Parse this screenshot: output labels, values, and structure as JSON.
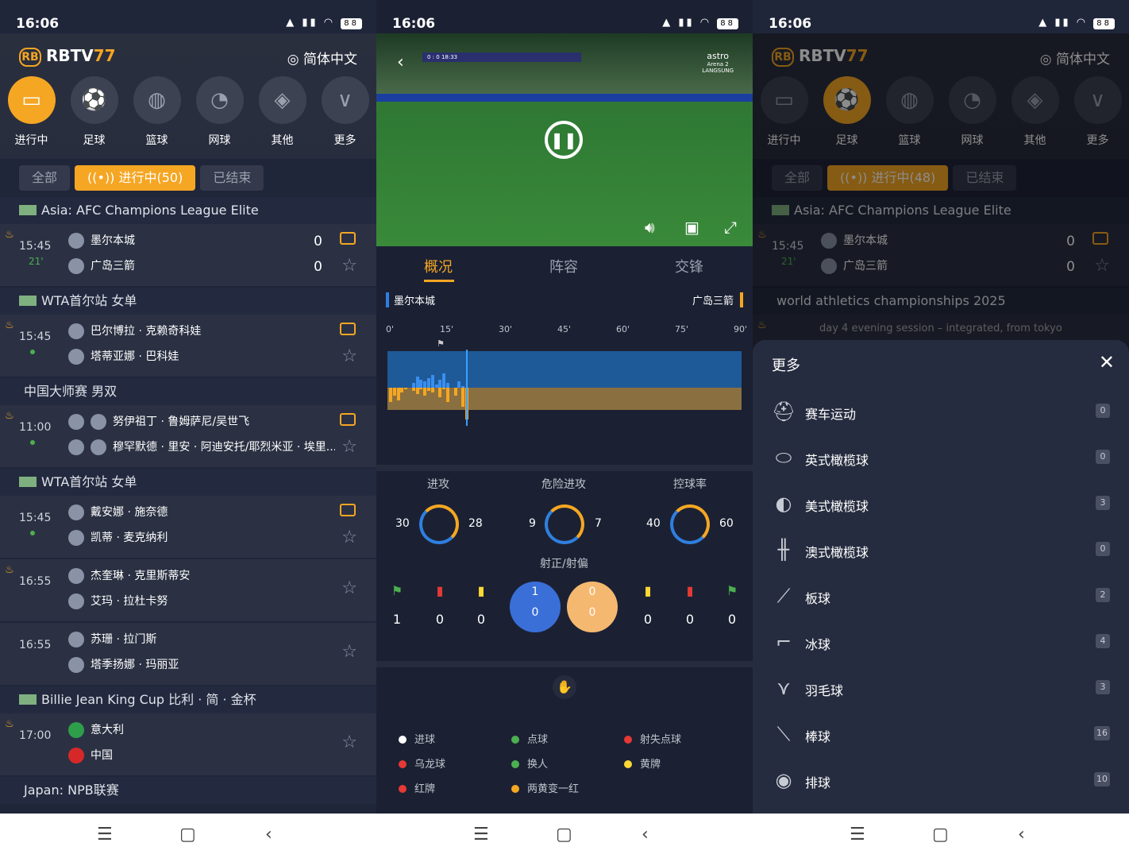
{
  "status": {
    "time": "16:06",
    "battery": "88"
  },
  "p1": {
    "logo_b": "RBTV",
    "logo_n": "77",
    "logo_rb": "RB",
    "lang": "简体中文",
    "cats": [
      "进行中",
      "足球",
      "篮球",
      "网球",
      "其他",
      "更多"
    ],
    "tabs": [
      "全部",
      "((•)) 进行中(50)",
      "已结束"
    ],
    "l1": "Asia: AFC Champions League Elite",
    "m1": {
      "time": "15:45",
      "min": "21'",
      "t1": "墨尔本城",
      "t2": "广岛三箭",
      "s1": "0",
      "s2": "0"
    },
    "l2": "WTA首尔站 女单",
    "m2": {
      "time": "15:45",
      "t1": "巴尔博拉 · 克赖奇科娃",
      "t2": "塔蒂亚娜 · 巴科娃"
    },
    "l3": "中国大师赛 男双",
    "m3": {
      "time": "11:00",
      "t1": "努伊祖丁 · 鲁姆萨尼/吴世飞",
      "t2": "穆罕默德 · 里安 · 阿迪安托/耶烈米亚 · 埃里..."
    },
    "l4": "WTA首尔站 女单",
    "m4": {
      "time": "15:45",
      "t1": "戴安娜 · 施奈德",
      "t2": "凯蒂 · 麦克纳利"
    },
    "m5": {
      "time": "16:55",
      "t1": "杰奎琳 · 克里斯蒂安",
      "t2": "艾玛 · 拉杜卡努"
    },
    "m6": {
      "time": "16:55",
      "t1": "苏珊 · 拉门斯",
      "t2": "塔季扬娜 · 玛丽亚"
    },
    "l5": "Billie Jean King Cup 比利 · 简 · 金杯",
    "m7": {
      "time": "17:00",
      "t1": "意大利",
      "t2": "中国"
    },
    "l6": "Japan: NPB联赛"
  },
  "p2": {
    "tabs": [
      "概况",
      "阵容",
      "交锋"
    ],
    "home": "墨尔本城",
    "away": "广岛三箭",
    "axis": [
      "0'",
      "15'",
      "30'",
      "45'",
      "60'",
      "75'",
      "90'"
    ],
    "stats": [
      {
        "label": "进攻",
        "home": "30",
        "away": "28"
      },
      {
        "label": "危险进攻",
        "home": "9",
        "away": "7"
      },
      {
        "label": "控球率",
        "home": "40",
        "away": "60"
      }
    ],
    "shots_label": "射正/射偏",
    "home_events": [
      "1",
      "0",
      "0"
    ],
    "away_events": [
      "0",
      "0",
      "0"
    ],
    "home_shots": {
      "on": "1",
      "off": "0"
    },
    "away_shots": {
      "on": "0",
      "off": "0"
    },
    "legend": [
      "进球",
      "点球",
      "射失点球",
      "乌龙球",
      "换人",
      "黄牌",
      "红牌",
      "两黄变一红"
    ],
    "video": {
      "score": "0 : 0",
      "time": "18:33",
      "channel": "astro",
      "channel2": "Arena 2",
      "sponsor": "LANGSUNG"
    }
  },
  "p3": {
    "tabs": [
      "全部",
      "((•)) 进行中(48)",
      "已结束"
    ],
    "l2": "world athletics championships 2025",
    "peek": "day 4 evening session – integrated, from tokyo",
    "sheet_title": "更多",
    "items": [
      {
        "name": "赛车运动",
        "count": "0"
      },
      {
        "name": "英式橄榄球",
        "count": "0"
      },
      {
        "name": "美式橄榄球",
        "count": "3"
      },
      {
        "name": "澳式橄榄球",
        "count": "0"
      },
      {
        "name": "板球",
        "count": "2"
      },
      {
        "name": "冰球",
        "count": "4"
      },
      {
        "name": "羽毛球",
        "count": "3"
      },
      {
        "name": "棒球",
        "count": "16"
      },
      {
        "name": "排球",
        "count": "10"
      }
    ]
  }
}
